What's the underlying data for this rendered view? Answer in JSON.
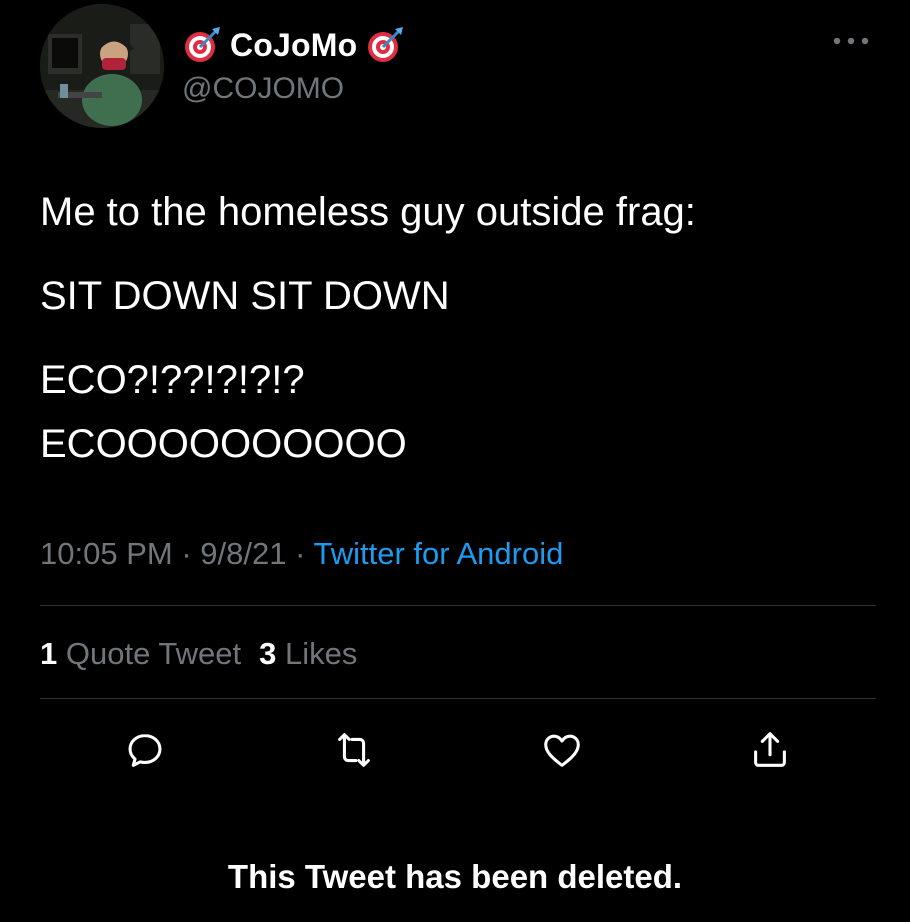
{
  "author": {
    "display_name": "CoJoMo",
    "handle": "@COJOMO",
    "name_emoji": "direct-hit-dart-icon"
  },
  "tweet": {
    "lines": [
      "Me to the homeless guy outside frag:",
      "SIT DOWN SIT DOWN",
      "ECO?!??!?!?!?",
      "ECOOOOOOOOOO"
    ],
    "time": "10:05 PM",
    "date": "9/8/21",
    "separator": "·",
    "source": "Twitter for Android"
  },
  "stats": {
    "quote_count": "1",
    "quote_label": "Quote Tweet",
    "likes_count": "3",
    "likes_label": "Likes"
  },
  "actions": [
    "reply-icon",
    "retweet-icon",
    "like-icon",
    "share-icon"
  ],
  "footer": {
    "message": "This Tweet has been deleted."
  },
  "colors": {
    "background": "#000000",
    "text": "#ffffff",
    "secondary": "#71767b",
    "link": "#1d9bf0",
    "divider": "#2f3336"
  }
}
